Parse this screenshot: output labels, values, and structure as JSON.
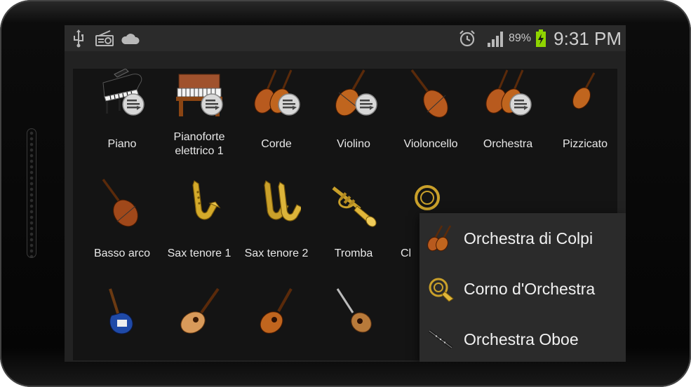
{
  "statusbar": {
    "left_icons": [
      "usb-icon",
      "radio-icon",
      "cloud-icon"
    ],
    "right_icons": [
      "alarm-icon",
      "signal-icon",
      "battery-charging-icon"
    ],
    "battery": "89%",
    "time": "9:31 PM"
  },
  "instruments": {
    "row1": [
      {
        "label": "Piano",
        "icon": "grand-piano-icon",
        "badge": true
      },
      {
        "label": "Pianoforte elettrico 1",
        "icon": "electric-piano-icon",
        "badge": true
      },
      {
        "label": "Corde",
        "icon": "strings-icon",
        "badge": true
      },
      {
        "label": "Violino",
        "icon": "violin-icon",
        "badge": true
      },
      {
        "label": "Violoncello",
        "icon": "cello-icon",
        "badge": false
      },
      {
        "label": "Orchestra",
        "icon": "orchestra-icon",
        "badge": true
      },
      {
        "label": "Pizzicato",
        "icon": "pizzicato-violin-icon",
        "badge": false
      }
    ],
    "row2": [
      {
        "label": "Basso arco",
        "icon": "double-bass-icon"
      },
      {
        "label": "Sax tenore 1",
        "icon": "saxophone-icon"
      },
      {
        "label": "Sax tenore 2",
        "icon": "two-saxophones-icon"
      },
      {
        "label": "Tromba",
        "icon": "trumpet-icon"
      },
      {
        "label": "Cl",
        "icon": "french-horn-icon"
      }
    ],
    "row3_icons": [
      "electric-guitar-icon",
      "acoustic-guitar-icon",
      "classical-guitar-icon",
      "mandolin-icon",
      "guitar-icon",
      "red-guitar-icon",
      "banjo-icon"
    ]
  },
  "popup_menu": {
    "items": [
      {
        "label": "Orchestra di Colpi",
        "icon": "violins-icon"
      },
      {
        "label": "Corno d'Orchestra",
        "icon": "french-horn-icon"
      },
      {
        "label": "Orchestra Oboe",
        "icon": "oboe-icon"
      }
    ]
  },
  "colors": {
    "screen_bg": "#141414",
    "statusbar_bg": "#2b2b2b",
    "popup_bg": "#2b2b2b",
    "text": "#e8e8e8",
    "battery_green": "#8fd400"
  }
}
